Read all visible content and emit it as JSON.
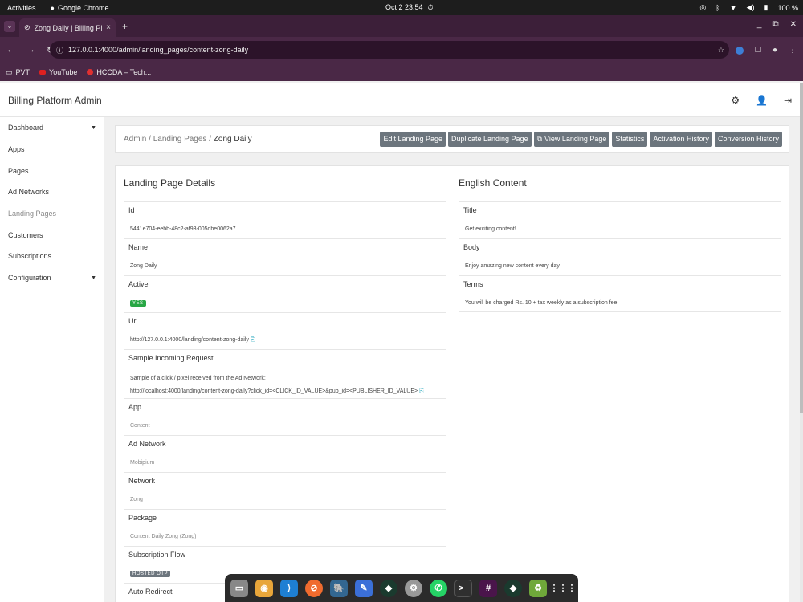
{
  "system": {
    "activities": "Activities",
    "app_name": "Google Chrome",
    "clock": "Oct 2  23:54",
    "battery": "100 %"
  },
  "browser": {
    "tab_title": "Zong Daily | Billing Platf",
    "url": "127.0.0.1:4000/admin/landing_pages/content-zong-daily",
    "bookmarks": [
      "PVT",
      "YouTube",
      "HCCDA – Tech..."
    ]
  },
  "app": {
    "title": "Billing Platform Admin"
  },
  "sidebar": {
    "items": [
      {
        "label": "Dashboard"
      },
      {
        "label": "Apps"
      },
      {
        "label": "Pages"
      },
      {
        "label": "Ad Networks"
      },
      {
        "label": "Landing Pages"
      },
      {
        "label": "Customers"
      },
      {
        "label": "Subscriptions"
      },
      {
        "label": "Configuration"
      }
    ]
  },
  "breadcrumb": {
    "admin": "Admin",
    "sep1": " / ",
    "landing_pages": "Landing Pages",
    "sep2": " / ",
    "current": "Zong Daily"
  },
  "actions": {
    "edit": "Edit Landing Page",
    "duplicate": "Duplicate Landing Page",
    "view": "View Landing Page",
    "statistics": "Statistics",
    "activation_history": "Activation History",
    "conversion_history": "Conversion History"
  },
  "details": {
    "title": "Landing Page Details",
    "fields": [
      {
        "label": "Id",
        "value": "5441e704-eebb-48c2-af93-005dbe0062a7"
      },
      {
        "label": "Name",
        "value": "Zong Daily"
      },
      {
        "label": "Active",
        "value": "YES"
      },
      {
        "label": "Url",
        "value": "http://127.0.0.1:4000/landing/content-zong-daily"
      },
      {
        "label": "Sample Incoming Request",
        "value": "Sample of a click / pixel received from the Ad Network:",
        "value2": "http://localhost:4000/landing/content-zong-daily?click_id=<CLICK_ID_VALUE>&pub_id=<PUBLISHER_ID_VALUE>"
      },
      {
        "label": "App",
        "value": "Content"
      },
      {
        "label": "Ad Network",
        "value": "Mobipium"
      },
      {
        "label": "Network",
        "value": "Zong"
      },
      {
        "label": "Package",
        "value": "Content Daily Zong (Zong)"
      },
      {
        "label": "Subscription Flow",
        "value": "HOSTED OTP"
      },
      {
        "label": "Auto Redirect",
        "value": ""
      }
    ]
  },
  "english": {
    "title": "English Content",
    "fields": [
      {
        "label": "Title",
        "value": "Get exciting content!"
      },
      {
        "label": "Body",
        "value": "Enjoy amazing new content every day"
      },
      {
        "label": "Terms",
        "value": "You will be charged Rs. 10 + tax weekly as a subscription fee"
      }
    ]
  },
  "colors": {
    "chrome_frame": "#3c1f39",
    "button_gray": "#6c757d",
    "badge_green": "#28a745"
  }
}
